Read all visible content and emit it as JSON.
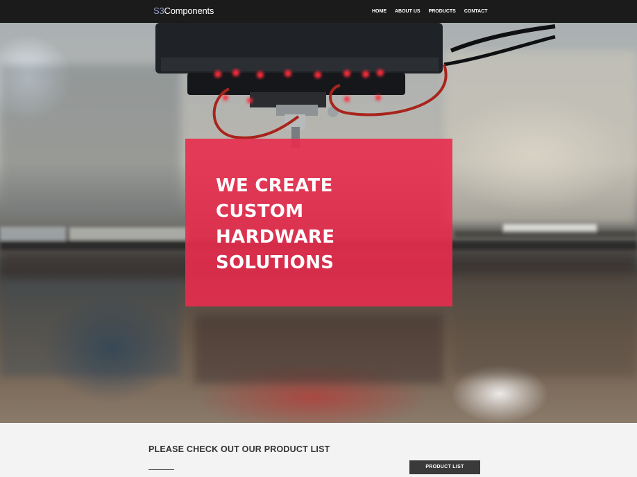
{
  "header": {
    "brand_prefix": "S3",
    "brand_name": "Components",
    "nav": [
      {
        "label": "HOME"
      },
      {
        "label": "ABOUT US"
      },
      {
        "label": "PRODUCTS"
      },
      {
        "label": "CONTACT"
      }
    ]
  },
  "hero": {
    "headline_lines": [
      "WE CREATE",
      "CUSTOM",
      "HARDWARE",
      "SOLUTIONS"
    ],
    "card_color": "#e82c4e"
  },
  "cta": {
    "heading": "PLEASE CHECK OUT OUR PRODUCT LIST",
    "button_label": "PRODUCT LIST"
  },
  "colors": {
    "navbar_bg": "#1b1b1b",
    "brand_accent": "#8f9fc4",
    "button_bg": "#3a3a3a",
    "section_bg": "#f3f3f3"
  }
}
